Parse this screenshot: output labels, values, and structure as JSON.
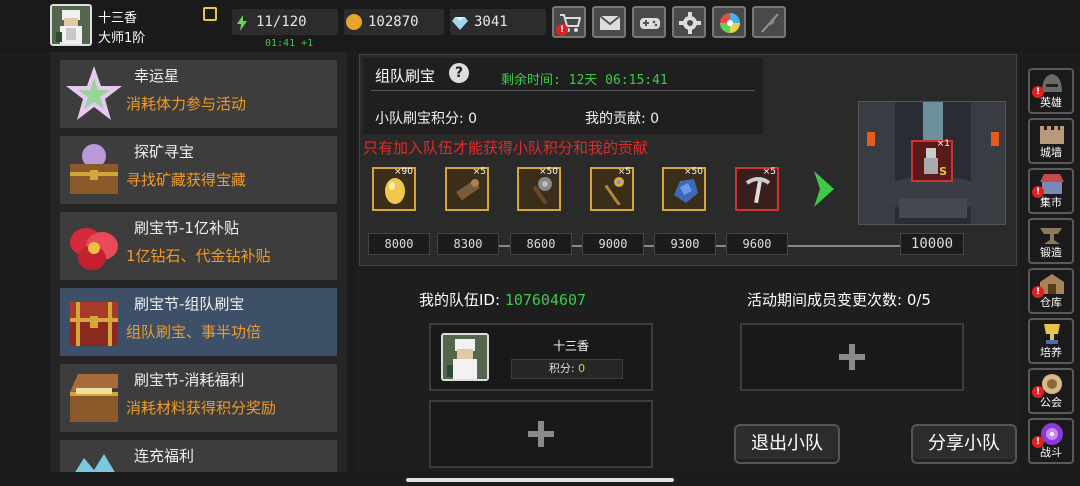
{
  "player": {
    "name": "十三香",
    "rank": "大师1阶"
  },
  "resources": {
    "stamina": "11/120",
    "stamina_timer": "01:41 +1",
    "gold": "102870",
    "diamonds": "3041"
  },
  "top_buttons": [
    "shop-cart-icon",
    "mail-icon",
    "gamepad-icon",
    "gear-icon",
    "gacha-wheel-icon",
    "quill-icon"
  ],
  "events": [
    {
      "title": "幸运星",
      "desc": "消耗体力参与活动",
      "icon": "lucky-star-icon"
    },
    {
      "title": "探矿寻宝",
      "desc": "寻找矿藏获得宝藏",
      "icon": "treasure-chest-icon"
    },
    {
      "title": "刷宝节-1亿补贴",
      "desc": "1亿钻石、代金钻补贴",
      "icon": "red-flower-icon"
    },
    {
      "title": "刷宝节-组队刷宝",
      "desc": "组队刷宝、事半功倍",
      "icon": "red-chest-icon"
    },
    {
      "title": "刷宝节-消耗福利",
      "desc": "消耗材料获得积分奖励",
      "icon": "open-chest-icon"
    },
    {
      "title": "连充福利",
      "desc": "",
      "icon": "crystal-icon"
    }
  ],
  "panel": {
    "title": "组队刷宝",
    "remaining_label": "剩余时间: 12天 06:15:41",
    "team_score_label": "小队刷宝积分: 0",
    "contribution_label": "我的贡献: 0",
    "warning": "只有加入队伍才能获得小队积分和我的贡献"
  },
  "rewards": [
    {
      "item": "golden-egg-icon",
      "qty": "×90"
    },
    {
      "item": "scroll-icon",
      "qty": "×5"
    },
    {
      "item": "mace-icon",
      "qty": "×50"
    },
    {
      "item": "staff-icon",
      "qty": "×5"
    },
    {
      "item": "blue-ore-icon",
      "qty": "×50"
    },
    {
      "item": "pickaxe-icon",
      "qty": "×5"
    }
  ],
  "thresholds": [
    "8000",
    "8300",
    "8600",
    "9000",
    "9300",
    "9600",
    "10000"
  ],
  "final_reward": {
    "qty": "×1",
    "grade": "S"
  },
  "team": {
    "id_label": "我的队伍ID:",
    "id": "107604607",
    "change_label": "活动期间成员变更次数: 0/5",
    "member_name": "十三香",
    "member_score_label": "积分:",
    "member_score": "0"
  },
  "buttons": {
    "leave": "退出小队",
    "share": "分享小队"
  },
  "right_nav": [
    {
      "label": "英雄",
      "alert": true
    },
    {
      "label": "城墙",
      "alert": false
    },
    {
      "label": "集市",
      "alert": true
    },
    {
      "label": "锻造",
      "alert": false
    },
    {
      "label": "仓库",
      "alert": true
    },
    {
      "label": "培养",
      "alert": false
    },
    {
      "label": "公会",
      "alert": true
    },
    {
      "label": "战斗",
      "alert": true
    }
  ],
  "colors": {
    "green_text": "#3ec94a",
    "orange_text": "#f09a2a",
    "warning_red": "#e02a2a",
    "active_item": "#3e5068"
  }
}
